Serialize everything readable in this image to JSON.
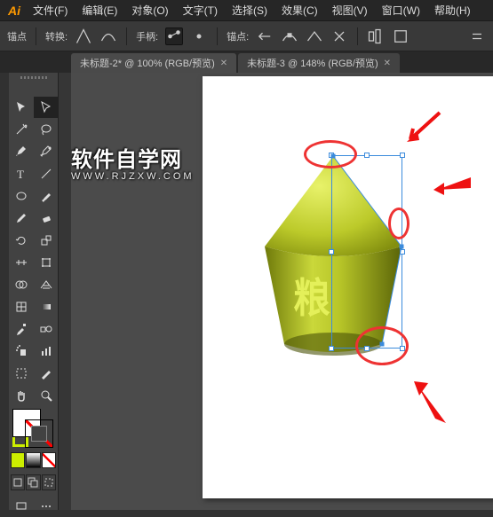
{
  "menubar": {
    "logo": "Ai",
    "items": [
      {
        "label": "文件(F)"
      },
      {
        "label": "编辑(E)"
      },
      {
        "label": "对象(O)"
      },
      {
        "label": "文字(T)"
      },
      {
        "label": "选择(S)"
      },
      {
        "label": "效果(C)"
      },
      {
        "label": "视图(V)"
      },
      {
        "label": "窗口(W)"
      },
      {
        "label": "帮助(H)"
      }
    ]
  },
  "controlbar": {
    "anchor_label": "锚点",
    "convert_label": "转换:",
    "handles_label": "手柄:",
    "anchors_label": "锚点:"
  },
  "tabs": [
    {
      "label": "未标题-2* @ 100% (RGB/预览)",
      "active": true
    },
    {
      "label": "未标题-3 @ 148% (RGB/预览)",
      "active": false
    }
  ],
  "tools": {
    "selection": "selection-tool",
    "direct": "direct-selection-tool",
    "wand": "magic-wand-tool",
    "lasso": "lasso-tool",
    "pen": "pen-tool",
    "curve": "curvature-tool",
    "type": "type-tool",
    "line": "line-segment-tool",
    "ellipse": "ellipse-tool",
    "brush": "paintbrush-tool",
    "pencil": "pencil-tool",
    "eraser": "eraser-tool",
    "rotate": "rotate-tool",
    "scale": "scale-tool",
    "width": "width-tool",
    "free": "free-transform-tool",
    "shape_builder": "shape-builder-tool",
    "perspective": "perspective-grid-tool",
    "mesh": "mesh-tool",
    "gradient": "gradient-tool",
    "eyedropper": "eyedropper-tool",
    "blend": "blend-tool",
    "symbol": "symbol-sprayer-tool",
    "graph": "column-graph-tool",
    "artboard": "artboard-tool",
    "slice": "slice-tool",
    "hand": "hand-tool",
    "zoom": "zoom-tool"
  },
  "swatches": {
    "fill": "#ffffff",
    "stroke": "none",
    "accent": "#ccee00"
  },
  "canvas": {
    "object_label": "粮"
  },
  "watermark": {
    "title": "软件自学网",
    "url": "WWW.RJZXW.COM"
  }
}
